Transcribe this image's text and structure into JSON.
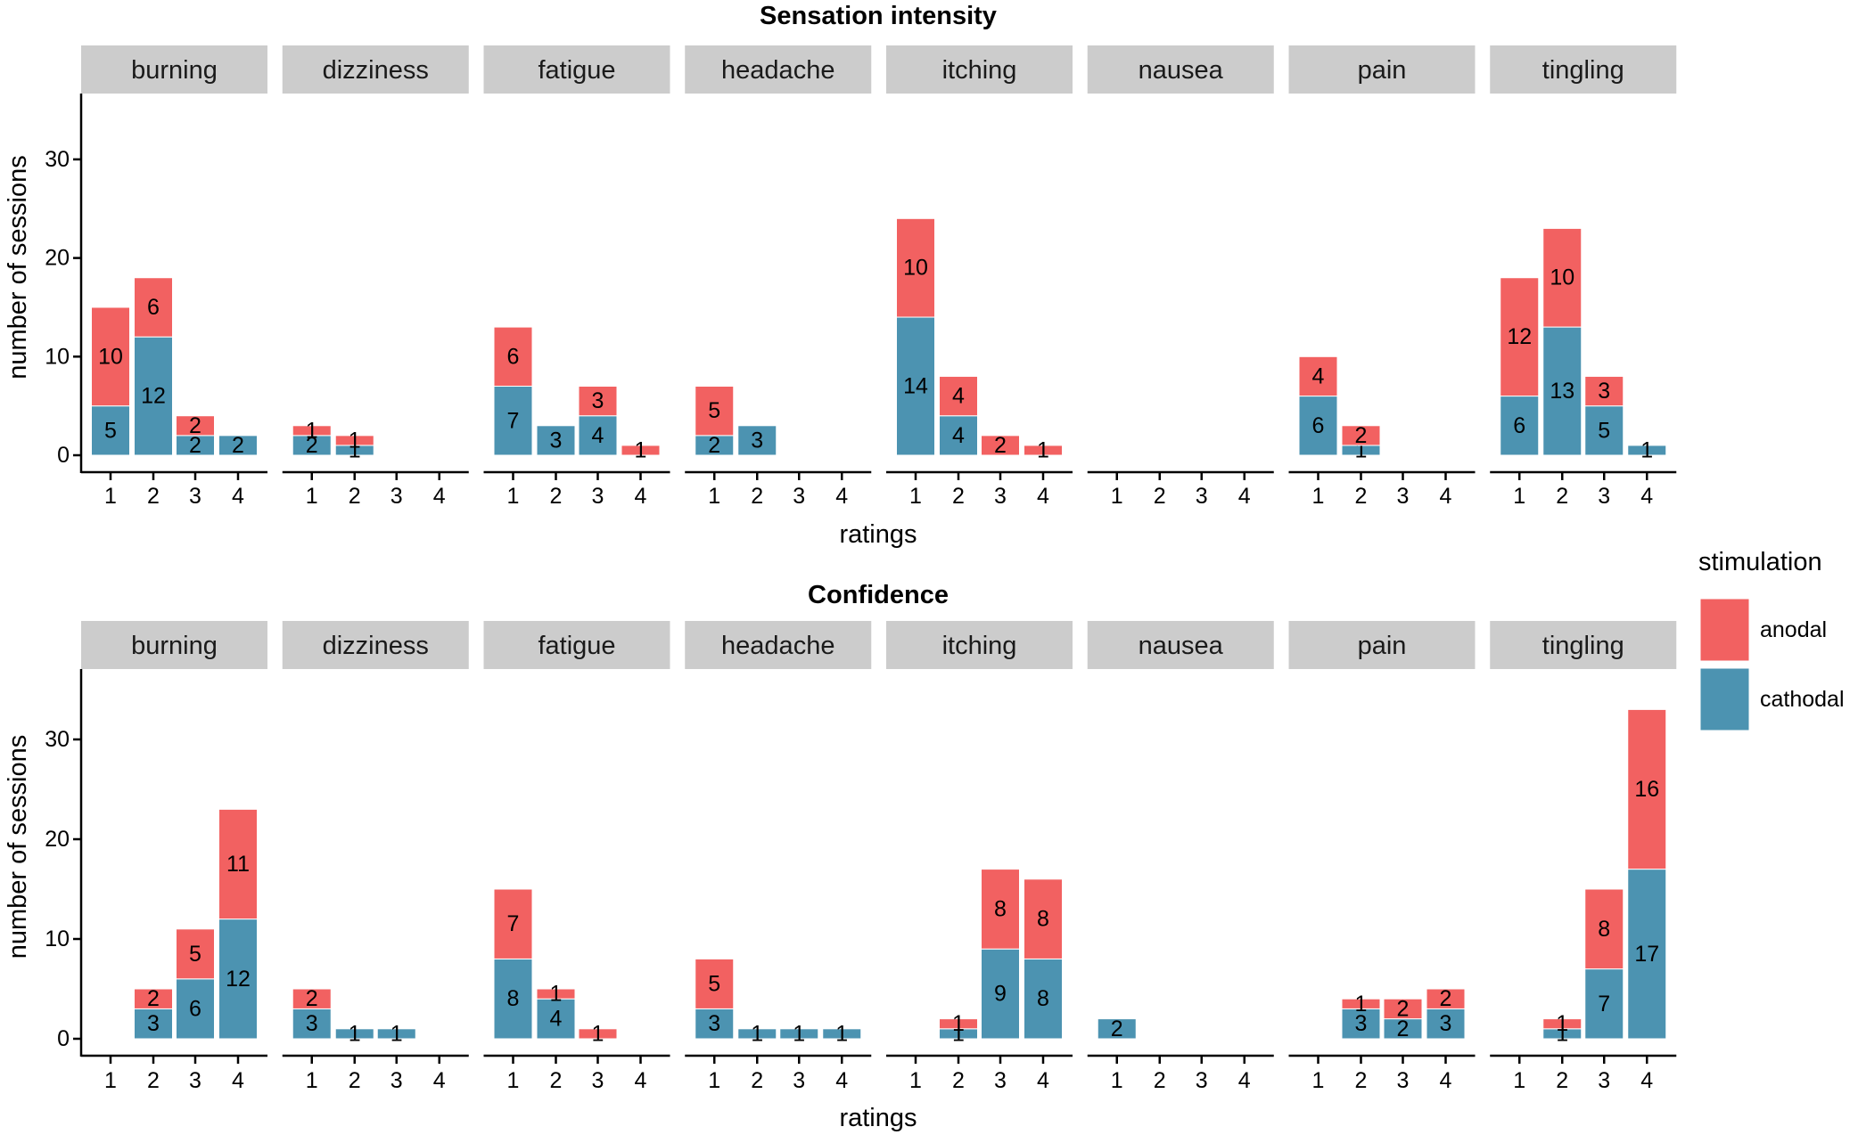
{
  "chart_data": {
    "type": "bar",
    "stacked": true,
    "facets": [
      "burning",
      "dizziness",
      "fatigue",
      "headache",
      "itching",
      "nausea",
      "pain",
      "tingling"
    ],
    "x_categories": [
      "1",
      "2",
      "3",
      "4"
    ],
    "xlabel": "ratings",
    "ylabel": "number of sessions",
    "y_ticks": [
      0,
      10,
      20,
      30
    ],
    "ylim": [
      0,
      36
    ],
    "grid": false,
    "legend": {
      "title": "stimulation",
      "placement": "right",
      "entries": [
        {
          "name": "anodal",
          "color": "#F26161"
        },
        {
          "name": "cathodal",
          "color": "#4C93B1"
        }
      ]
    },
    "stack_order_bottom_to_top": [
      "cathodal",
      "anodal"
    ],
    "panels": [
      {
        "title": "Sensation intensity",
        "data": {
          "burning": {
            "cathodal": [
              5,
              12,
              2,
              2
            ],
            "anodal": [
              10,
              6,
              2,
              0
            ]
          },
          "dizziness": {
            "cathodal": [
              2,
              1,
              0,
              0
            ],
            "anodal": [
              1,
              1,
              0,
              0
            ]
          },
          "fatigue": {
            "cathodal": [
              7,
              3,
              4,
              0
            ],
            "anodal": [
              6,
              0,
              3,
              1
            ]
          },
          "headache": {
            "cathodal": [
              2,
              3,
              0,
              0
            ],
            "anodal": [
              5,
              0,
              0,
              0
            ]
          },
          "itching": {
            "cathodal": [
              14,
              4,
              0,
              0
            ],
            "anodal": [
              10,
              4,
              2,
              1
            ]
          },
          "nausea": {
            "cathodal": [
              0,
              0,
              0,
              0
            ],
            "anodal": [
              0,
              0,
              0,
              0
            ]
          },
          "pain": {
            "cathodal": [
              6,
              1,
              0,
              0
            ],
            "anodal": [
              4,
              2,
              0,
              0
            ]
          },
          "tingling": {
            "cathodal": [
              6,
              13,
              5,
              1
            ],
            "anodal": [
              12,
              10,
              3,
              0
            ]
          }
        }
      },
      {
        "title": "Confidence",
        "data": {
          "burning": {
            "cathodal": [
              0,
              3,
              6,
              12
            ],
            "anodal": [
              0,
              2,
              5,
              11
            ]
          },
          "dizziness": {
            "cathodal": [
              3,
              1,
              1,
              0
            ],
            "anodal": [
              2,
              0,
              0,
              0
            ]
          },
          "fatigue": {
            "cathodal": [
              8,
              4,
              0,
              0
            ],
            "anodal": [
              7,
              1,
              1,
              0
            ]
          },
          "headache": {
            "cathodal": [
              3,
              1,
              1,
              1
            ],
            "anodal": [
              5,
              0,
              0,
              0
            ]
          },
          "itching": {
            "cathodal": [
              0,
              1,
              9,
              8
            ],
            "anodal": [
              0,
              1,
              8,
              8
            ]
          },
          "nausea": {
            "cathodal": [
              2,
              0,
              0,
              0
            ],
            "anodal": [
              0,
              0,
              0,
              0
            ]
          },
          "pain": {
            "cathodal": [
              0,
              3,
              2,
              3
            ],
            "anodal": [
              0,
              1,
              2,
              2
            ]
          },
          "tingling": {
            "cathodal": [
              0,
              1,
              7,
              17
            ],
            "anodal": [
              0,
              1,
              8,
              16
            ]
          }
        }
      }
    ]
  }
}
